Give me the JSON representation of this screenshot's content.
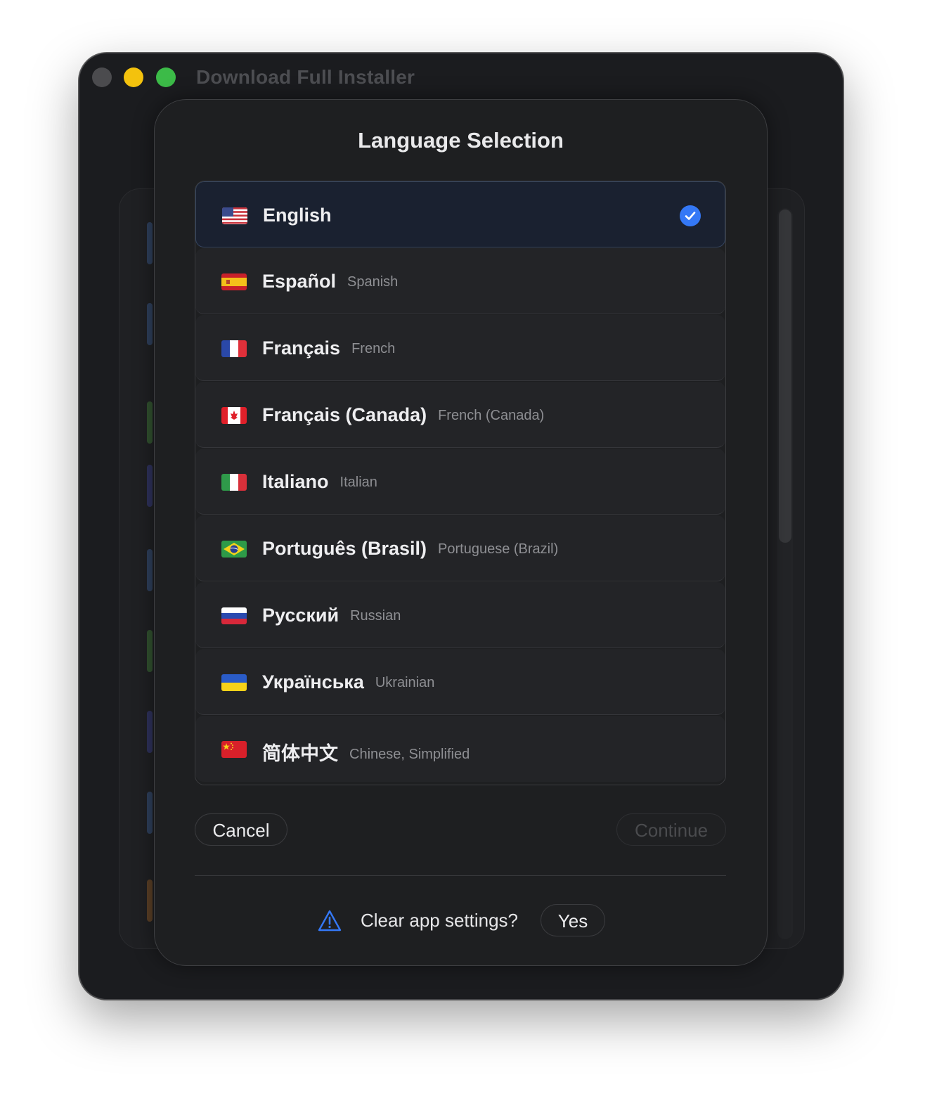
{
  "window": {
    "title": "Download Full Installer"
  },
  "sheet": {
    "title": "Language Selection",
    "languages": [
      {
        "native": "English",
        "english": "",
        "flag": "us-flag-icon",
        "selected": true
      },
      {
        "native": "Español",
        "english": "Spanish",
        "flag": "es-flag-icon",
        "selected": false
      },
      {
        "native": "Français",
        "english": "French",
        "flag": "fr-flag-icon",
        "selected": false
      },
      {
        "native": "Français (Canada)",
        "english": "French (Canada)",
        "flag": "ca-flag-icon",
        "selected": false
      },
      {
        "native": "Italiano",
        "english": "Italian",
        "flag": "it-flag-icon",
        "selected": false
      },
      {
        "native": "Português (Brasil)",
        "english": "Portuguese (Brazil)",
        "flag": "br-flag-icon",
        "selected": false
      },
      {
        "native": "Русский",
        "english": "Russian",
        "flag": "ru-flag-icon",
        "selected": false
      },
      {
        "native": "Українська",
        "english": "Ukrainian",
        "flag": "ua-flag-icon",
        "selected": false
      },
      {
        "native": "简体中文",
        "english": "Chinese, Simplified",
        "flag": "cn-flag-icon",
        "selected": false
      }
    ],
    "cancel_label": "Cancel",
    "continue_label": "Continue",
    "clear_prompt": "Clear app settings?",
    "yes_label": "Yes"
  },
  "colors": {
    "accent": "#3478f6",
    "window_bg": "#1b1c1f",
    "sheet_bg": "#1e1f21",
    "selected_row_bg": "#1a2130",
    "traffic_close": "#4b4b4e",
    "traffic_minimize": "#f4c20d",
    "traffic_maximize": "#3cbb48"
  }
}
